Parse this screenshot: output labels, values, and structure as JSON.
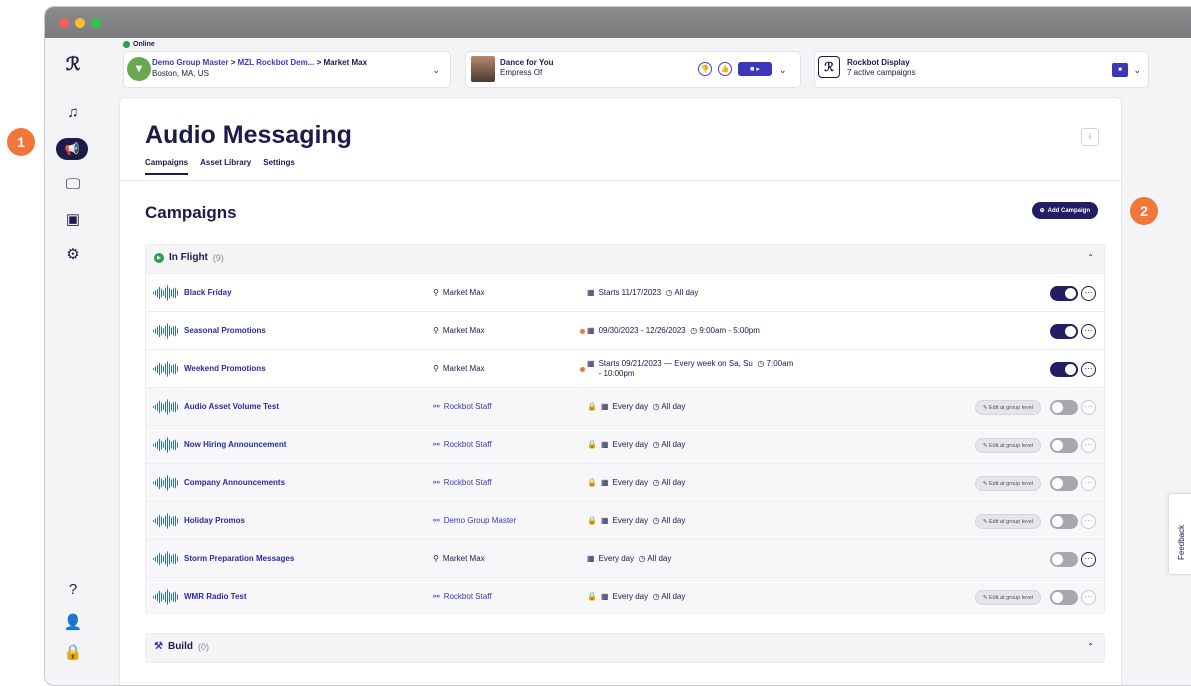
{
  "status": {
    "text": "Online"
  },
  "location": {
    "group": "Demo Group Master",
    "sep1": ">",
    "sub": "MZL Rockbot Dem...",
    "sep2": ">",
    "zone": "Market Max",
    "city": "Boston, MA, US"
  },
  "player": {
    "song": "Dance for You",
    "artist": "Empress Of"
  },
  "display": {
    "title": "Rockbot Display",
    "subtitle": "7 active campaigns"
  },
  "page": {
    "title": "Audio Messaging",
    "tabs": [
      "Campaigns",
      "Asset Library",
      "Settings"
    ],
    "section_title": "Campaigns",
    "add_button": "Add Campaign"
  },
  "badges": [
    "1",
    "2"
  ],
  "groups": {
    "in_flight": {
      "label": "In Flight",
      "count": "(9)"
    },
    "build": {
      "label": "Build",
      "count": "(0)"
    }
  },
  "campaigns": [
    {
      "name": "Black Friday",
      "location": "Market Max",
      "schedule": "Starts 11/17/2023",
      "time": "All day",
      "enabled": true
    },
    {
      "name": "Seasonal Promotions",
      "location": "Market Max",
      "schedule": "09/30/2023 - 12/26/2023",
      "time": "9:00am - 5:00pm",
      "enabled": true
    },
    {
      "name": "Weekend Promotions",
      "location": "Market Max",
      "schedule": "Starts 09/21/2023   —   Every week on Sa, Su",
      "time": "7:00am",
      "time2": "- 10:00pm",
      "enabled": true
    },
    {
      "name": "Audio Asset Volume Test",
      "location": "Rockbot Staff",
      "schedule": "Every day",
      "time": "All day",
      "enabled": false,
      "edit": "Edit at group level"
    },
    {
      "name": "Now Hiring Announcement",
      "location": "Rockbot Staff",
      "schedule": "Every day",
      "time": "All day",
      "enabled": false,
      "edit": "Edit at group level"
    },
    {
      "name": "Company Announcements",
      "location": "Rockbot Staff",
      "schedule": "Every day",
      "time": "All day",
      "enabled": false,
      "edit": "Edit at group level"
    },
    {
      "name": "Holiday Promos",
      "location": "Demo Group Master",
      "schedule": "Every day",
      "time": "All day",
      "enabled": false,
      "edit": "Edit at group level"
    },
    {
      "name": "Storm Preparation Messages",
      "location": "Market Max",
      "schedule": "Every day",
      "time": "All day",
      "enabled": false
    },
    {
      "name": "WMR Radio Test",
      "location": "Rockbot Staff",
      "schedule": "Every day",
      "time": "All day",
      "enabled": false,
      "edit": "Edit at group level"
    }
  ],
  "feedback": {
    "label": "Feedback"
  }
}
